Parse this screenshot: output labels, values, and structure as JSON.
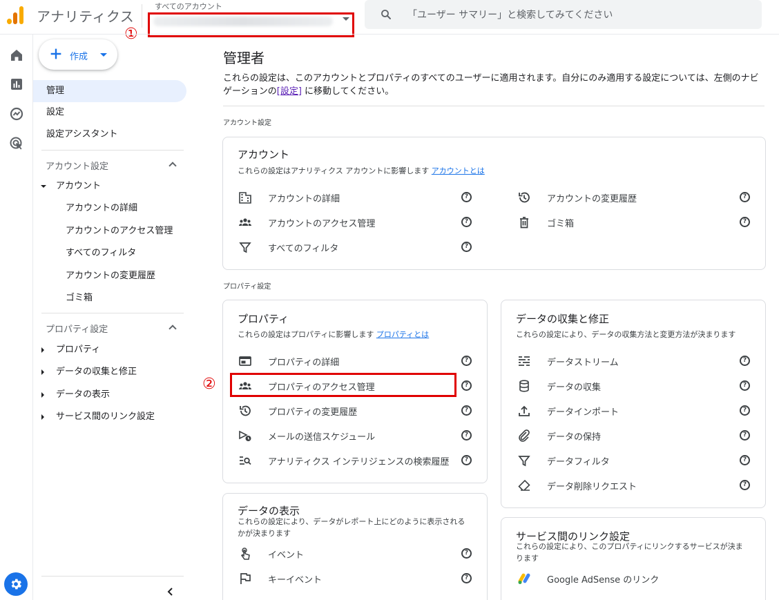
{
  "header": {
    "app_title": "アナリティクス",
    "account_label": "すべてのアカウント",
    "search_placeholder": "「ユーザー サマリー」と検索してみてください"
  },
  "annotations": {
    "marker1": "①",
    "marker2": "②"
  },
  "sidebar": {
    "create_label": "作成",
    "top_items": [
      "管理",
      "設定",
      "設定アシスタント"
    ],
    "account_section": {
      "heading": "アカウント設定",
      "group_label": "アカウント",
      "items": [
        "アカウントの詳細",
        "アカウントのアクセス管理",
        "すべてのフィルタ",
        "アカウントの変更履歴",
        "ゴミ箱"
      ]
    },
    "property_section": {
      "heading": "プロパティ設定",
      "items": [
        "プロパティ",
        "データの収集と修正",
        "データの表示",
        "サービス間のリンク設定"
      ]
    }
  },
  "main": {
    "title": "管理者",
    "desc_part1": "これらの設定は、このアカウントとプロパティのすべてのユーザーに適用されます。自分にのみ適用する設定については、左側のナビゲーションの",
    "desc_link": "[設定]",
    "desc_part2": " に移動してください。",
    "account_section_label": "アカウント設定",
    "property_section_label": "プロパティ設定",
    "account_card": {
      "title": "アカウント",
      "desc": "これらの設定はアナリティクス アカウントに影響します",
      "desc_link": "アカウントとは",
      "left_items": [
        "アカウントの詳細",
        "アカウントのアクセス管理",
        "すべてのフィルタ"
      ],
      "right_items": [
        "アカウントの変更履歴",
        "ゴミ箱"
      ]
    },
    "property_card": {
      "title": "プロパティ",
      "desc": "これらの設定はプロパティに影響します",
      "desc_link": "プロパティとは",
      "items": [
        "プロパティの詳細",
        "プロパティのアクセス管理",
        "プロパティの変更履歴",
        "メールの送信スケジュール",
        "アナリティクス インテリジェンスの検索履歴"
      ]
    },
    "data_collection_card": {
      "title": "データの収集と修正",
      "desc": "これらの設定により、データの収集方法と変更方法が決まります",
      "items": [
        "データストリーム",
        "データの収集",
        "データインポート",
        "データの保持",
        "データフィルタ",
        "データ削除リクエスト"
      ]
    },
    "data_display_card": {
      "title": "データの表示",
      "desc_line1": "これらの設定により、データがレポート上にどのように表示される",
      "desc_line2": "かが決まります",
      "items": [
        "イベント",
        "キーイベント"
      ]
    },
    "links_card": {
      "title": "サービス間のリンク設定",
      "desc_line1": "これらの設定により、このプロパティにリンクするサービスが決ま",
      "desc_line2": "ります",
      "items": [
        "Google AdSense のリンク"
      ]
    }
  },
  "colors": {
    "accent": "#1a73e8",
    "annotation": "#e00000",
    "active_bg": "#e8f0fe"
  }
}
